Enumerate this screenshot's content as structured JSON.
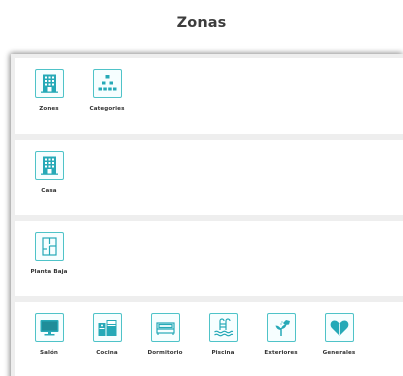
{
  "page": {
    "title": "Zonas"
  },
  "colors": {
    "accent": "#26a9b7",
    "icon_border": "#4fc3c8",
    "frame_bg": "#eeeeee"
  },
  "sections": [
    {
      "tiles": [
        {
          "label": "Zones",
          "icon": "building-icon"
        },
        {
          "label": "Categories",
          "icon": "hierarchy-icon"
        }
      ]
    },
    {
      "tiles": [
        {
          "label": "Casa",
          "icon": "building-icon"
        }
      ]
    },
    {
      "tiles": [
        {
          "label": "Planta Baja",
          "icon": "floor-plan-icon"
        }
      ]
    },
    {
      "tiles": [
        {
          "label": "Salón",
          "icon": "tv-icon"
        },
        {
          "label": "Cocina",
          "icon": "kitchen-icon"
        },
        {
          "label": "Dormitorio",
          "icon": "bed-icon"
        },
        {
          "label": "Piscina",
          "icon": "pool-icon"
        },
        {
          "label": "Exteriores",
          "icon": "watering-can-icon"
        },
        {
          "label": "Generales",
          "icon": "heart-icon"
        }
      ]
    }
  ]
}
